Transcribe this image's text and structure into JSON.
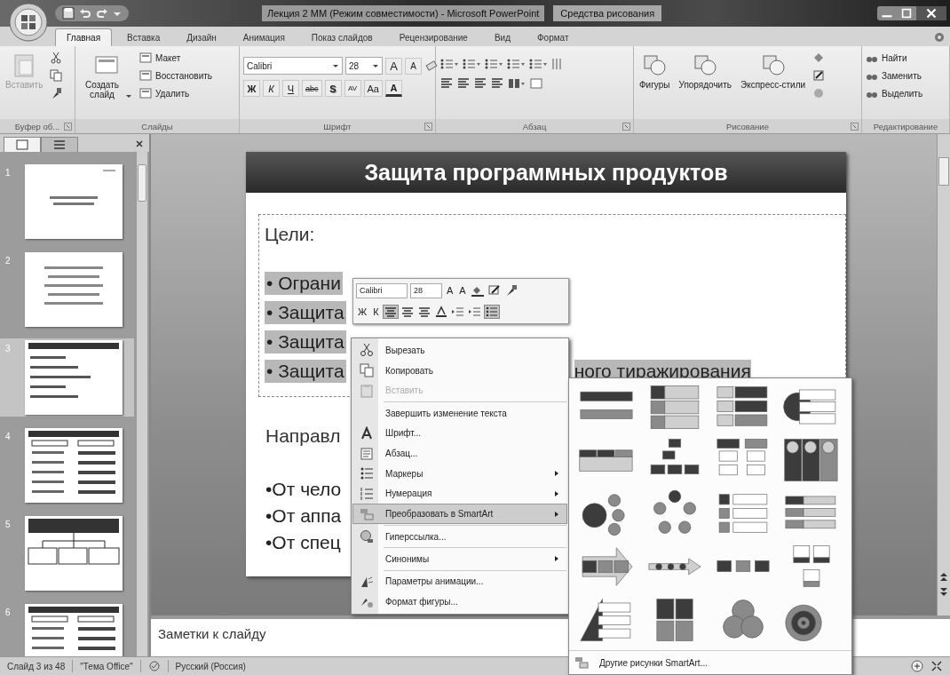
{
  "title_bar": {
    "title": "Лекция 2 ММ (Режим совместимости) - Microsoft PowerPoint",
    "context_tab": "Средства рисования"
  },
  "tabs": [
    {
      "label": "Главная",
      "selected": true
    },
    {
      "label": "Вставка",
      "selected": false
    },
    {
      "label": "Дизайн",
      "selected": false
    },
    {
      "label": "Анимация",
      "selected": false
    },
    {
      "label": "Показ слайдов",
      "selected": false
    },
    {
      "label": "Рецензирование",
      "selected": false
    },
    {
      "label": "Вид",
      "selected": false
    },
    {
      "label": "Формат",
      "selected": false
    }
  ],
  "ribbon": {
    "clipboard": {
      "label": "Буфер об...",
      "paste": "Вставить"
    },
    "slides": {
      "label": "Слайды",
      "new_slide": "Создать слайд",
      "items": [
        "Макет",
        "Восстановить",
        "Удалить"
      ]
    },
    "font": {
      "label": "Шрифт",
      "font": "Calibri",
      "size": "28",
      "size_buttons": [
        "A",
        "A"
      ],
      "format_buttons": [
        "Ж",
        "К",
        "Ч",
        "abc",
        "S",
        "AV",
        "Aa",
        "A"
      ]
    },
    "paragraph": {
      "label": "Абзац"
    },
    "drawing": {
      "label": "Рисование",
      "buttons": [
        "Фигуры",
        "Упорядочить",
        "Экспресс-стили"
      ]
    },
    "editing": {
      "label": "Редактирование",
      "items": [
        "Найти",
        "Заменить",
        "Выделить"
      ]
    }
  },
  "slides_panel": {
    "slides": [
      {
        "number": "1",
        "kind": "title",
        "selected": false
      },
      {
        "number": "2",
        "kind": "text",
        "selected": false
      },
      {
        "number": "3",
        "kind": "list",
        "selected": true
      },
      {
        "number": "4",
        "kind": "table",
        "selected": false
      },
      {
        "number": "5",
        "kind": "chart",
        "selected": false
      },
      {
        "number": "6",
        "kind": "table",
        "selected": false
      }
    ]
  },
  "slide": {
    "title": "Защита программных продуктов",
    "heading": "Цели:",
    "goals": [
      {
        "text": "• Ограни",
        "highlighted": true
      },
      {
        "text": "• Защита",
        "highlighted": true
      },
      {
        "text": "• Защита",
        "highlighted": true
      },
      {
        "text": "• Защита",
        "tail": "ного тиражирования",
        "highlighted": true
      }
    ],
    "subheading": "Направл",
    "directions": [
      "•От чело",
      "•От аппа",
      "•От спец"
    ]
  },
  "notes": {
    "placeholder": "Заметки к слайду"
  },
  "status_bar": {
    "slide": "Слайд 3 из 48",
    "theme": "\"Тема Office\"",
    "language": "Русский (Россия)"
  },
  "mini_toolbar": {
    "font": "Calibri",
    "size": "28",
    "size_buttons": [
      "A",
      "A"
    ],
    "format_buttons": [
      "Ж",
      "К"
    ]
  },
  "context_menu": {
    "items": [
      {
        "kind": "item",
        "label": "Вырезать",
        "disabled": false,
        "submenu": false,
        "selected": false
      },
      {
        "kind": "item",
        "label": "Копировать",
        "disabled": false,
        "submenu": false,
        "selected": false
      },
      {
        "kind": "item",
        "label": "Вставить",
        "disabled": true,
        "submenu": false,
        "selected": false
      },
      {
        "kind": "separator"
      },
      {
        "kind": "item",
        "label": "Завершить изменение текста",
        "disabled": false,
        "submenu": false,
        "selected": false
      },
      {
        "kind": "item",
        "label": "Шрифт...",
        "disabled": false,
        "submenu": false,
        "selected": false
      },
      {
        "kind": "item",
        "label": "Абзац...",
        "disabled": false,
        "submenu": false,
        "selected": false
      },
      {
        "kind": "item",
        "label": "Маркеры",
        "disabled": false,
        "submenu": true,
        "selected": false
      },
      {
        "kind": "item",
        "label": "Нумерация",
        "disabled": false,
        "submenu": true,
        "selected": false
      },
      {
        "kind": "item",
        "label": "Преобразовать в SmartArt",
        "disabled": false,
        "submenu": true,
        "selected": true
      },
      {
        "kind": "separator"
      },
      {
        "kind": "item",
        "label": "Гиперссылка...",
        "disabled": false,
        "submenu": false,
        "selected": false
      },
      {
        "kind": "separator"
      },
      {
        "kind": "item",
        "label": "Синонимы",
        "disabled": false,
        "submenu": true,
        "selected": false
      },
      {
        "kind": "separator"
      },
      {
        "kind": "item",
        "label": "Параметры анимации...",
        "disabled": false,
        "submenu": false,
        "selected": false
      },
      {
        "kind": "item",
        "label": "Формат фигуры...",
        "disabled": false,
        "submenu": false,
        "selected": false
      }
    ]
  },
  "smartart_gallery": {
    "more": "Другие рисунки SmartArt..."
  }
}
